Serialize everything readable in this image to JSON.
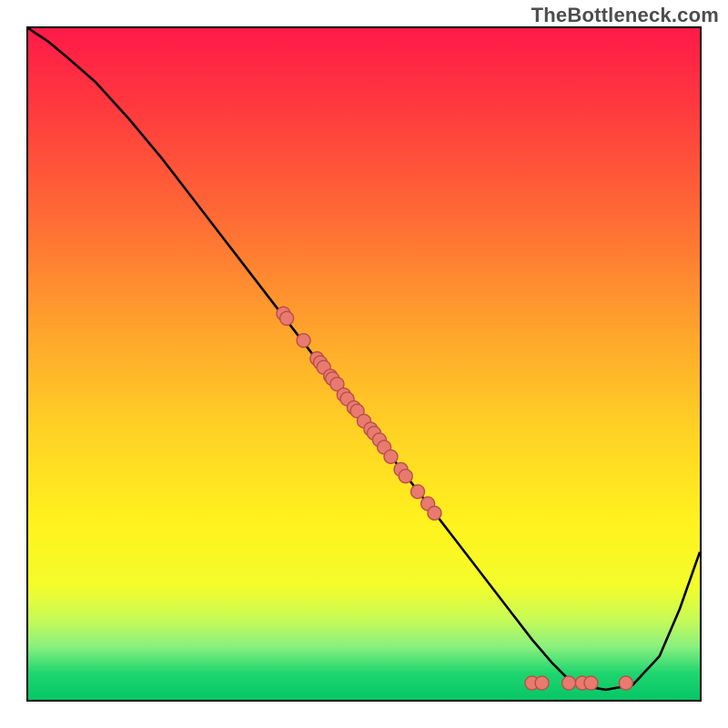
{
  "watermark": "TheBottleneck.com",
  "colors": {
    "gradient_top": "#ff1a48",
    "gradient_bottom": "#07c566",
    "curve": "#000000",
    "point_fill": "#e87a70",
    "point_stroke": "#b94e48",
    "border": "#000000"
  },
  "chart_data": {
    "type": "line",
    "title": "",
    "xlabel": "",
    "ylabel": "",
    "xlim": [
      0,
      100
    ],
    "ylim": [
      0,
      100
    ],
    "curve": {
      "x": [
        0,
        3,
        6,
        10,
        15,
        20,
        25,
        30,
        35,
        40,
        45,
        50,
        55,
        60,
        65,
        70,
        75,
        78,
        80,
        83,
        86,
        90,
        94,
        97,
        100
      ],
      "y": [
        100,
        98,
        95.5,
        92,
        86.5,
        80.5,
        74,
        67.5,
        61,
        54.5,
        48,
        41.5,
        35,
        28.5,
        22,
        15.5,
        9,
        5.5,
        3.5,
        2.0,
        1.5,
        2.2,
        6.5,
        13.5,
        22
      ]
    },
    "points": [
      {
        "x": 38,
        "y": 57.5
      },
      {
        "x": 38.5,
        "y": 56.8
      },
      {
        "x": 41,
        "y": 53.5
      },
      {
        "x": 43,
        "y": 50.8
      },
      {
        "x": 43.5,
        "y": 50.2
      },
      {
        "x": 44,
        "y": 49.5
      },
      {
        "x": 45,
        "y": 48.2
      },
      {
        "x": 45.3,
        "y": 47.8
      },
      {
        "x": 46,
        "y": 47.0
      },
      {
        "x": 47,
        "y": 45.4
      },
      {
        "x": 47.5,
        "y": 44.8
      },
      {
        "x": 48.5,
        "y": 43.5
      },
      {
        "x": 49,
        "y": 43.0
      },
      {
        "x": 50,
        "y": 41.5
      },
      {
        "x": 51,
        "y": 40.3
      },
      {
        "x": 51.5,
        "y": 39.7
      },
      {
        "x": 52.3,
        "y": 38.7
      },
      {
        "x": 53,
        "y": 37.6
      },
      {
        "x": 54,
        "y": 36.2
      },
      {
        "x": 55.5,
        "y": 34.3
      },
      {
        "x": 56.2,
        "y": 33.3
      },
      {
        "x": 58,
        "y": 31.0
      },
      {
        "x": 59.5,
        "y": 29.2
      },
      {
        "x": 60.5,
        "y": 27.8
      },
      {
        "x": 75.0,
        "y": 2.5
      },
      {
        "x": 76.5,
        "y": 2.5
      },
      {
        "x": 80.5,
        "y": 2.5
      },
      {
        "x": 82.5,
        "y": 2.5
      },
      {
        "x": 83.8,
        "y": 2.5
      },
      {
        "x": 89.0,
        "y": 2.5
      }
    ]
  }
}
